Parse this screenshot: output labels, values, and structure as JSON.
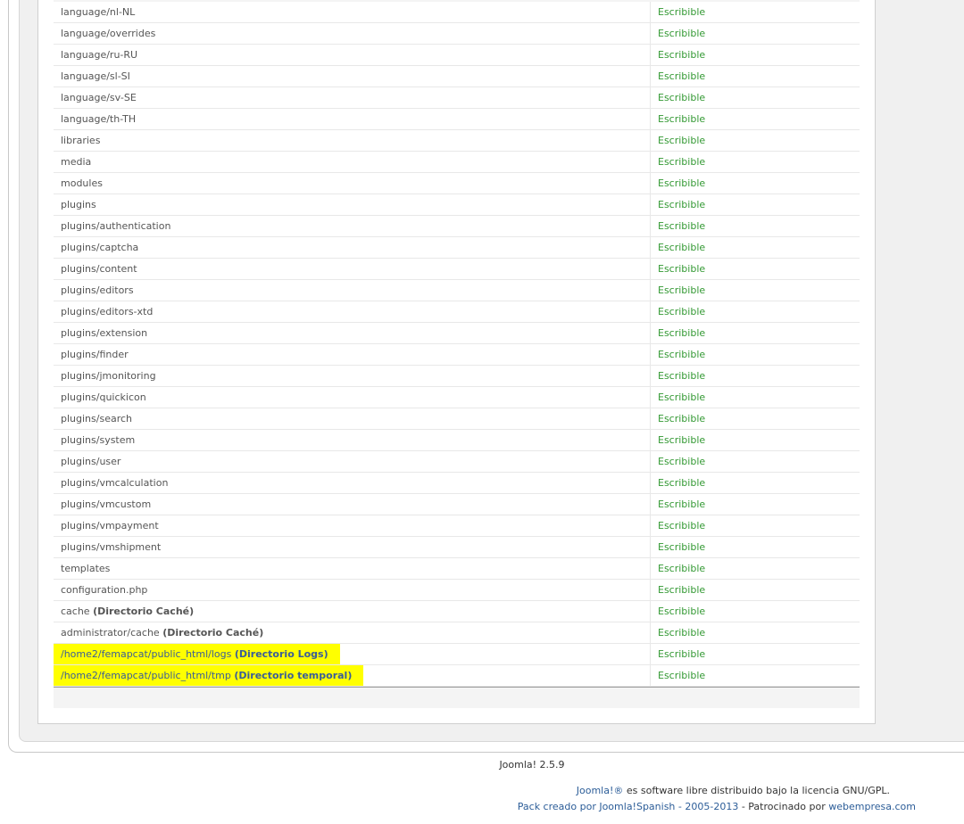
{
  "rows": [
    {
      "path": "language/nl-NL",
      "label": "",
      "status": "Escribible"
    },
    {
      "path": "language/overrides",
      "label": "",
      "status": "Escribible"
    },
    {
      "path": "language/ru-RU",
      "label": "",
      "status": "Escribible"
    },
    {
      "path": "language/sl-SI",
      "label": "",
      "status": "Escribible"
    },
    {
      "path": "language/sv-SE",
      "label": "",
      "status": "Escribible"
    },
    {
      "path": "language/th-TH",
      "label": "",
      "status": "Escribible"
    },
    {
      "path": "libraries",
      "label": "",
      "status": "Escribible"
    },
    {
      "path": "media",
      "label": "",
      "status": "Escribible"
    },
    {
      "path": "modules",
      "label": "",
      "status": "Escribible"
    },
    {
      "path": "plugins",
      "label": "",
      "status": "Escribible"
    },
    {
      "path": "plugins/authentication",
      "label": "",
      "status": "Escribible"
    },
    {
      "path": "plugins/captcha",
      "label": "",
      "status": "Escribible"
    },
    {
      "path": "plugins/content",
      "label": "",
      "status": "Escribible"
    },
    {
      "path": "plugins/editors",
      "label": "",
      "status": "Escribible"
    },
    {
      "path": "plugins/editors-xtd",
      "label": "",
      "status": "Escribible"
    },
    {
      "path": "plugins/extension",
      "label": "",
      "status": "Escribible"
    },
    {
      "path": "plugins/finder",
      "label": "",
      "status": "Escribible"
    },
    {
      "path": "plugins/jmonitoring",
      "label": "",
      "status": "Escribible"
    },
    {
      "path": "plugins/quickicon",
      "label": "",
      "status": "Escribible"
    },
    {
      "path": "plugins/search",
      "label": "",
      "status": "Escribible"
    },
    {
      "path": "plugins/system",
      "label": "",
      "status": "Escribible"
    },
    {
      "path": "plugins/user",
      "label": "",
      "status": "Escribible"
    },
    {
      "path": "plugins/vmcalculation",
      "label": "",
      "status": "Escribible"
    },
    {
      "path": "plugins/vmcustom",
      "label": "",
      "status": "Escribible"
    },
    {
      "path": "plugins/vmpayment",
      "label": "",
      "status": "Escribible"
    },
    {
      "path": "plugins/vmshipment",
      "label": "",
      "status": "Escribible"
    },
    {
      "path": "templates",
      "label": "",
      "status": "Escribible"
    },
    {
      "path": "configuration.php",
      "label": "",
      "status": "Escribible"
    },
    {
      "path": "cache",
      "label": "(Directorio Caché)",
      "status": "Escribible"
    },
    {
      "path": "administrator/cache",
      "label": "(Directorio Caché)",
      "status": "Escribible"
    },
    {
      "path": "/home2/femapcat/public_html/logs",
      "label": "(Directorio Logs)",
      "status": "Escribible",
      "highlight": true
    },
    {
      "path": "/home2/femapcat/public_html/tmp",
      "label": "(Directorio temporal)",
      "status": "Escribible",
      "highlight": true
    }
  ],
  "colors": {
    "status_ok": "#339933",
    "highlight": "#ffff00",
    "link": "#2c5d98"
  },
  "footer": {
    "version": "Joomla! 2.5.9",
    "license_link": "Joomla!®",
    "license_text": " es software libre distribuido bajo la licencia GNU/GPL.",
    "pack_link": "Pack creado por Joomla!Spanish - 2005-2013",
    "pack_mid": " - Patrocinado por ",
    "sponsor_link": "webempresa.com"
  }
}
